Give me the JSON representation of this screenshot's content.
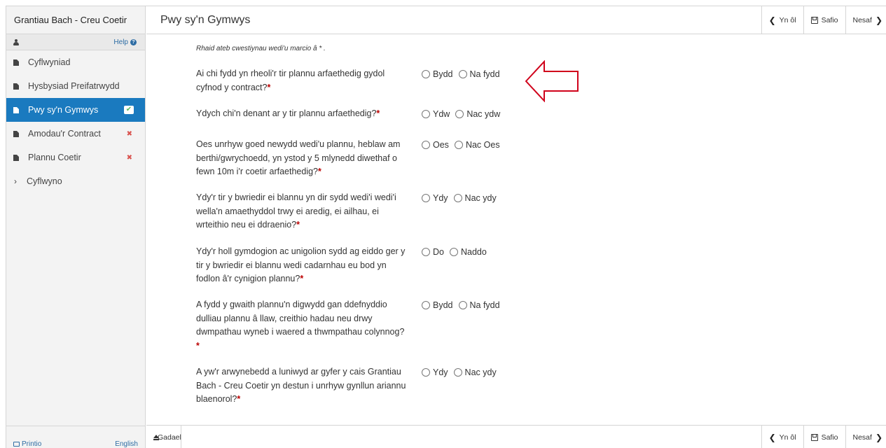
{
  "app": {
    "title": "Grantiau Bach - Creu Coetir"
  },
  "sidebar": {
    "help_label": "Help",
    "items": [
      {
        "label": "Cyflwyniad",
        "icon": "document-icon",
        "status": ""
      },
      {
        "label": "Hysbysiad Preifatrwydd",
        "icon": "document-icon",
        "status": ""
      },
      {
        "label": "Pwy sy'n Gymwys",
        "icon": "document-icon",
        "status": "complete",
        "status_glyph": "✔"
      },
      {
        "label": "Amodau'r Contract",
        "icon": "document-icon",
        "status": "error",
        "status_glyph": "✖"
      },
      {
        "label": "Plannu Coetir",
        "icon": "document-icon",
        "status": "error",
        "status_glyph": "✖"
      },
      {
        "label": "Cyflwyno",
        "icon": "chevron-right-icon",
        "status": ""
      }
    ],
    "print_label": "Printio",
    "language_label": "English"
  },
  "header": {
    "page_title": "Pwy sy'n Gymwys",
    "back_label": "Yn ôl",
    "save_label": "Safio",
    "next_label": "Nesaf",
    "back_glyph": "❮",
    "next_glyph": "❯"
  },
  "form": {
    "required_note": "Rhaid ateb cwestiynau wedi'u marcio â * .",
    "questions": [
      {
        "text": "Ai chi fydd yn rheoli'r tir plannu arfaethedig gydol cyfnod y contract?",
        "options": [
          "Bydd",
          "Na fydd"
        ]
      },
      {
        "text": "Ydych chi'n denant ar y tir plannu arfaethedig?",
        "options": [
          "Ydw",
          "Nac ydw"
        ]
      },
      {
        "text": "Oes unrhyw goed newydd wedi'u plannu, heblaw am berthi/gwrychoedd, yn ystod y 5 mlynedd diwethaf o fewn 10m i'r coetir arfaethedig?",
        "options": [
          "Oes",
          "Nac Oes"
        ]
      },
      {
        "text": "Ydy'r tir y bwriedir ei blannu yn dir sydd wedi'i wedi'i wella'n amaethyddol trwy ei aredig, ei ailhau, ei wrteithio neu ei ddraenio?",
        "options": [
          "Ydy",
          "Nac ydy"
        ]
      },
      {
        "text": "Ydy'r holl gymdogion ac unigolion sydd ag eiddo ger y tir y bwriedir ei blannu wedi cadarnhau eu bod yn fodlon â'r cynigion plannu?",
        "options": [
          "Do",
          "Naddo"
        ]
      },
      {
        "text": "A fydd y gwaith plannu'n digwydd gan ddefnyddio dulliau plannu â llaw, creithio hadau neu drwy dwmpathau wyneb i waered a thwmpathau colynnog?",
        "options": [
          "Bydd",
          "Na fydd"
        ]
      },
      {
        "text": "A yw'r arwynebedd a luniwyd ar gyfer y cais Grantiau Bach - Creu Coetir yn destun i unrhyw gynllun ariannu blaenorol?",
        "options": [
          "Ydy",
          "Nac ydy"
        ]
      }
    ],
    "required_star": "*"
  },
  "footer": {
    "leave_label": "Gadael",
    "back_label": "Yn ôl",
    "save_label": "Safio",
    "next_label": "Nesaf"
  },
  "colors": {
    "active_nav": "#1a7abf",
    "link": "#2e6da4",
    "error": "#d9534f",
    "success": "#5cb85c",
    "annotation_arrow": "#d0021b"
  }
}
